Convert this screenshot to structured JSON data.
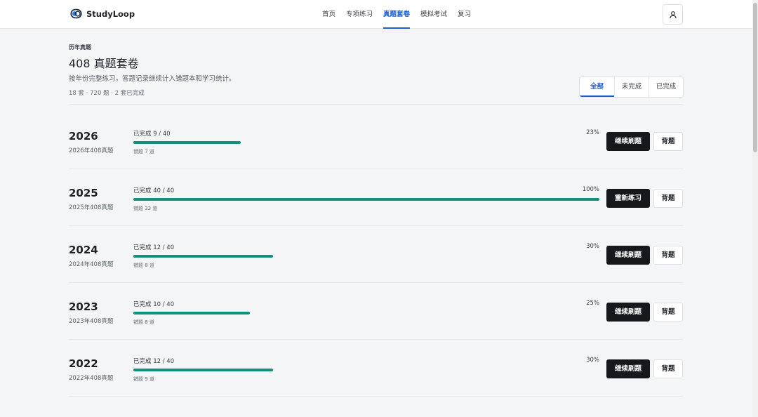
{
  "brand": {
    "name": "StudyLoop",
    "logo_icon": "loop-logo-icon"
  },
  "nav": {
    "items": [
      {
        "label": "首页",
        "active": false
      },
      {
        "label": "专项练习",
        "active": false
      },
      {
        "label": "真题套卷",
        "active": true
      },
      {
        "label": "模拟考试",
        "active": false
      },
      {
        "label": "复习",
        "active": false
      }
    ],
    "user_icon": "user-icon"
  },
  "header": {
    "eyebrow": "历年真题",
    "title": "408 真题套卷",
    "subtitle": "按年份完整练习，答题记录继续计入错题本和学习统计。",
    "stats": "18 套 · 720 题 · 2 套已完成"
  },
  "filter": {
    "tabs": [
      {
        "label": "全部",
        "active": true
      },
      {
        "label": "未完成",
        "active": false
      },
      {
        "label": "已完成",
        "active": false
      }
    ]
  },
  "colors": {
    "accent": "#1d5fd6",
    "progress": "#12907c",
    "primary_button": "#16181b"
  },
  "exams": [
    {
      "year": "2026",
      "name": "2026年408真题",
      "done": "已完成 9 / 40",
      "percent": "23%",
      "progress": 0.23,
      "wrong": "错题 7 道",
      "primary_label": "继续刷题",
      "secondary_label": "背题"
    },
    {
      "year": "2025",
      "name": "2025年408真题",
      "done": "已完成 40 / 40",
      "percent": "100%",
      "progress": 1.0,
      "wrong": "错题 33 道",
      "primary_label": "重新练习",
      "secondary_label": "背题"
    },
    {
      "year": "2024",
      "name": "2024年408真题",
      "done": "已完成 12 / 40",
      "percent": "30%",
      "progress": 0.3,
      "wrong": "错题 8 道",
      "primary_label": "继续刷题",
      "secondary_label": "背题"
    },
    {
      "year": "2023",
      "name": "2023年408真题",
      "done": "已完成 10 / 40",
      "percent": "25%",
      "progress": 0.25,
      "wrong": "错题 8 道",
      "primary_label": "继续刷题",
      "secondary_label": "背题"
    },
    {
      "year": "2022",
      "name": "2022年408真题",
      "done": "已完成 12 / 40",
      "percent": "30%",
      "progress": 0.3,
      "wrong": "错题 9 道",
      "primary_label": "继续刷题",
      "secondary_label": "背题"
    }
  ]
}
